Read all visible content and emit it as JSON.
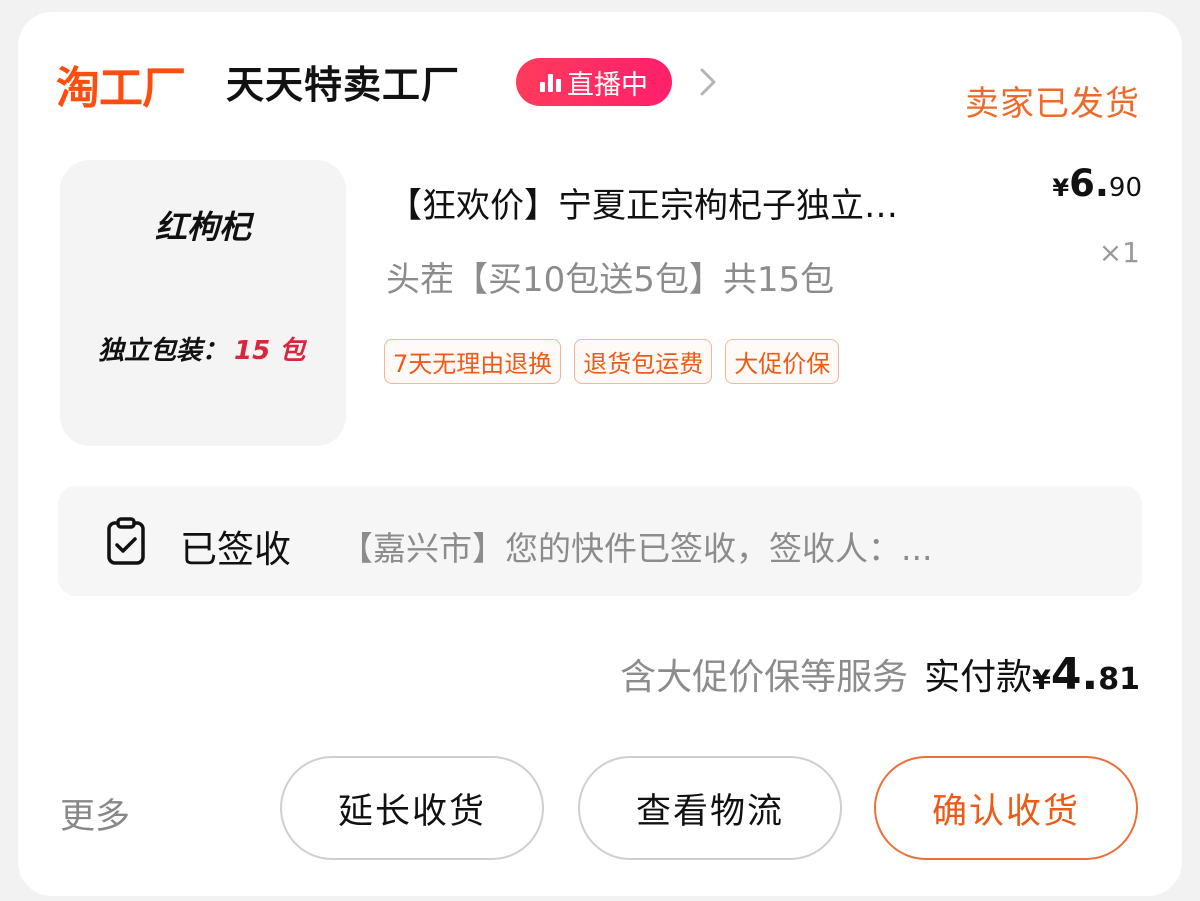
{
  "header": {
    "brand": "淘工厂",
    "shop_name": "天天特卖工厂",
    "live_label": "直播中",
    "order_status": "卖家已发货"
  },
  "product": {
    "image_title": "红枸杞",
    "image_pack_label": "独立包装：",
    "image_pack_count": "15 包",
    "title": "【狂欢价】宁夏正宗枸杞子独立…",
    "price_symbol": "¥",
    "price_int": "6.",
    "price_dec": "90",
    "quantity": "×1",
    "sku": "头茬【买10包送5包】共15包",
    "tags": [
      "7天无理由退换",
      "退货包运费",
      "大促价保"
    ]
  },
  "logistics": {
    "state": "已签收",
    "message": "【嘉兴市】您的快件已签收，签收人：..."
  },
  "total": {
    "service_note": "含大促价保等服务",
    "paid_label": "实付款",
    "symbol": "¥",
    "int": "4.",
    "dec": "81"
  },
  "actions": {
    "more": "更多",
    "extend": "延长收货",
    "view_logistics": "查看物流",
    "confirm": "确认收货"
  },
  "colors": {
    "brand": "#ff4d0f",
    "accent": "#ec5a14",
    "live": "#ff2a64"
  },
  "icons": {
    "live": "live-bars-icon",
    "chevron": "chevron-right-icon",
    "logistics": "clipboard-check-icon"
  }
}
